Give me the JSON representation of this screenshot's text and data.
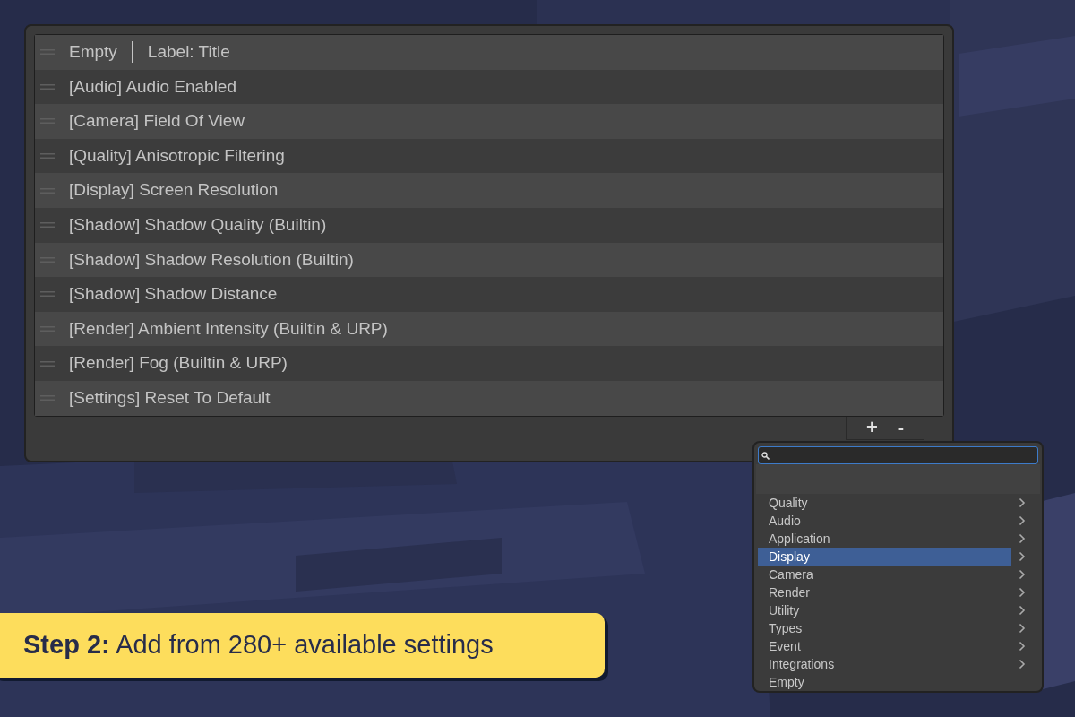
{
  "list": {
    "rows": [
      {
        "kind": "header",
        "parts": [
          "Empty",
          "Label: Title"
        ]
      },
      {
        "kind": "setting",
        "text": "[Audio] Audio Enabled"
      },
      {
        "kind": "setting",
        "text": "[Camera] Field Of View"
      },
      {
        "kind": "setting",
        "text": "[Quality] Anisotropic Filtering"
      },
      {
        "kind": "setting",
        "text": "[Display] Screen Resolution"
      },
      {
        "kind": "setting",
        "text": "[Shadow] Shadow Quality (Builtin)"
      },
      {
        "kind": "setting",
        "text": "[Shadow] Shadow Resolution (Builtin)"
      },
      {
        "kind": "setting",
        "text": "[Shadow] Shadow Distance"
      },
      {
        "kind": "setting",
        "text": "[Render] Ambient Intensity (Builtin & URP)"
      },
      {
        "kind": "setting",
        "text": "[Render] Fog (Builtin & URP)"
      },
      {
        "kind": "setting",
        "text": "[Settings] Reset To Default"
      }
    ],
    "buttons": [
      "+",
      "-"
    ]
  },
  "menu": {
    "items": [
      {
        "label": "Quality",
        "submenu": true,
        "selected": false
      },
      {
        "label": "Audio",
        "submenu": true,
        "selected": false
      },
      {
        "label": "Application",
        "submenu": true,
        "selected": false
      },
      {
        "label": "Display",
        "submenu": true,
        "selected": true
      },
      {
        "label": "Camera",
        "submenu": true,
        "selected": false
      },
      {
        "label": "Render",
        "submenu": true,
        "selected": false
      },
      {
        "label": "Utility",
        "submenu": true,
        "selected": false
      },
      {
        "label": "Types",
        "submenu": true,
        "selected": false
      },
      {
        "label": "Event",
        "submenu": true,
        "selected": false
      },
      {
        "label": "Integrations",
        "submenu": true,
        "selected": false
      },
      {
        "label": "Empty",
        "submenu": false,
        "selected": false
      }
    ]
  },
  "banner": {
    "text": "**Step 2:** Add from 280+ available settings"
  }
}
